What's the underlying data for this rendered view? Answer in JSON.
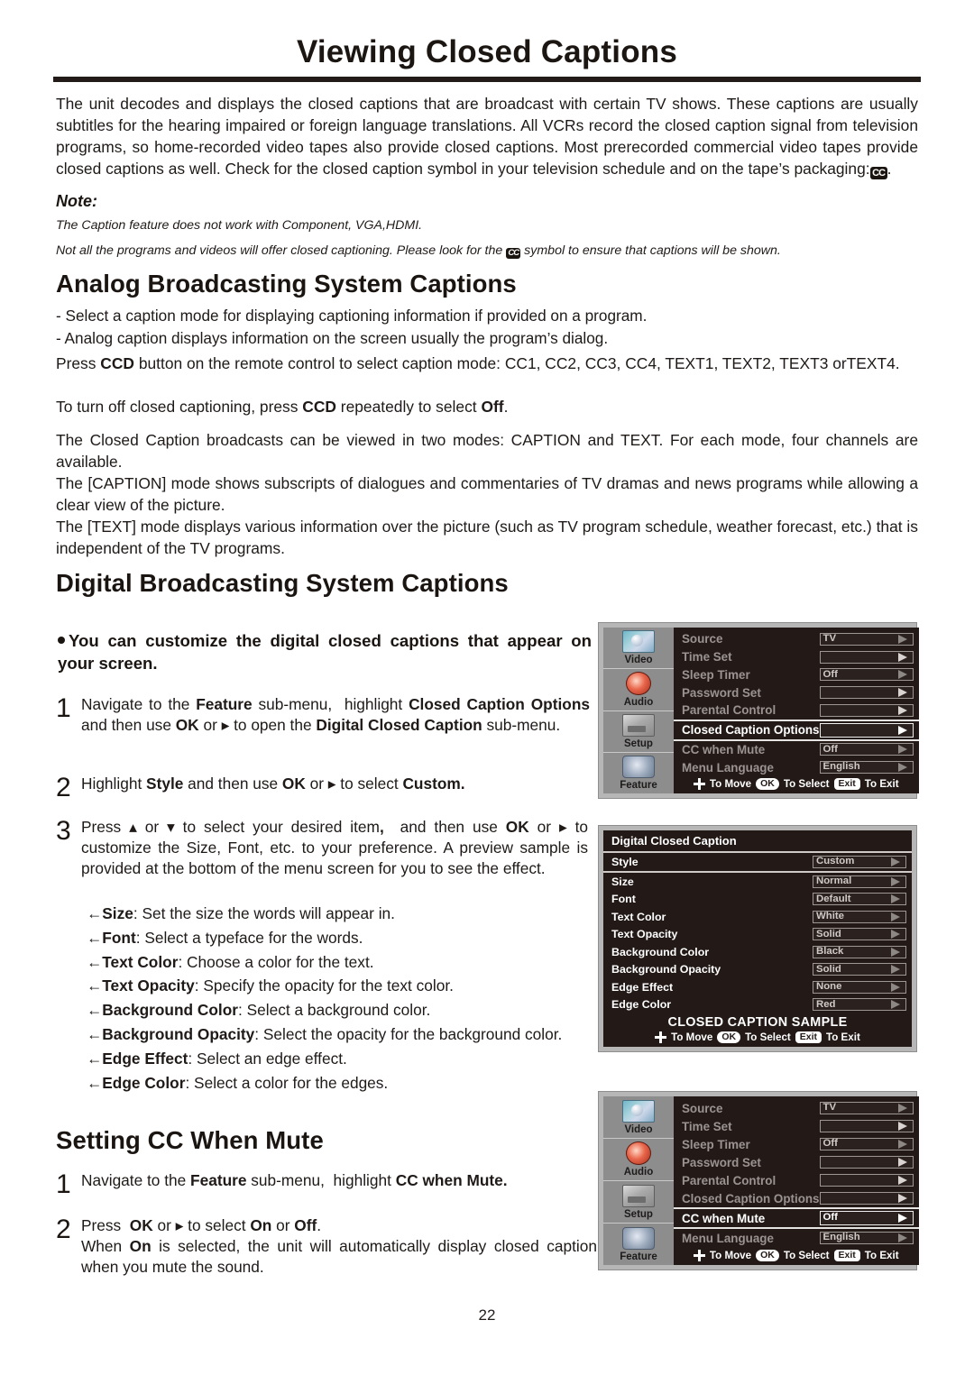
{
  "page": {
    "title": "Viewing Closed Captions",
    "number": "22"
  },
  "intro": {
    "paragraph_html": "The unit decodes and displays the closed captions that are broadcast with certain TV shows. These captions are usually subtitles for the hearing impaired or foreign language translations. All VCRs record the closed caption signal from television programs, so home-recorded video tapes also provide closed captions. Most prerecorded commercial video tapes provide closed captions as well. Check for the closed caption symbol in your television schedule and on the tape’s packaging:",
    "cc_symbol": "CC",
    "trailing": "."
  },
  "note": {
    "label": "Note:",
    "lines_1": "The Caption feature does not work with Component, VGA,HDMI.",
    "lines_2a": "Not all the programs and videos will offer closed captioning. Please look for the",
    "lines_2b": "symbol to ensure that captions will be shown.",
    "cc_symbol": "CC"
  },
  "analog": {
    "heading": "Analog Broadcasting System Captions",
    "dash1": "- Select a caption mode for displaying captioning information if provided on a program.",
    "dash2": "- Analog caption displays information on the screen usually the program’s dialog.",
    "p1_a": "Press ",
    "p1_b": "CCD",
    "p1_c": " button on the remote control to select caption mode: CC1, CC2, CC3, CC4, TEXT1, TEXT2, TEXT3 orTEXT4.",
    "p2_a": "To turn off closed captioning, press ",
    "p2_b": "CCD",
    "p2_c": " repeatedly to select ",
    "p2_d": "Off",
    "p2_e": ".",
    "p3": "The Closed Caption broadcasts can be viewed in two modes: CAPTION and TEXT. For each mode, four channels are available.",
    "p4": "The [CAPTION] mode shows subscripts of dialogues and commentaries of TV dramas and news programs while allowing a clear view of the picture.",
    "p5": "The [TEXT] mode displays various information over the picture (such as TV program schedule, weather forecast, etc.) that is independent of the TV programs."
  },
  "digital": {
    "heading": "Digital Broadcasting System Captions",
    "bullet": "You can customize the digital closed captions that appear on your screen.",
    "steps": [
      {
        "num": "1",
        "text_html": "Navigate to the <b>Feature</b> sub-menu,&nbsp; highlight <b>Closed Caption Options</b> and then use <b>OK</b> or &#9656; to open the <b>Digital Closed Caption</b> sub-menu."
      },
      {
        "num": "2",
        "text_html": "Highlight <b>Style</b> and then use <b>OK</b> or &#9656; to select <b>Custom.</b>"
      },
      {
        "num": "3",
        "text_html": "Press &#9652; or &#9662; to select your desired item<b>,</b>&nbsp; and then use <b>OK</b> or &#9656; to customize the Size, Font, etc. to your preference. A preview sample is provided at the bottom of the menu screen for you to see the effect."
      }
    ],
    "arrow_items": [
      {
        "term": "Size",
        "desc": ": Set the size the words will appear in."
      },
      {
        "term": "Font",
        "desc": ": Select a typeface for the words."
      },
      {
        "term": "Text Color",
        "desc": ": Choose a color for the text."
      },
      {
        "term": "Text Opacity",
        "desc": ": Specify the opacity for the text color."
      },
      {
        "term": "Background Color",
        "desc": ": Select a background color."
      },
      {
        "term": "Background Opacity",
        "desc": ": Select the opacity for the background color."
      },
      {
        "term": "Edge Effect",
        "desc": ": Select an edge effect."
      },
      {
        "term": "Edge Color",
        "desc": ": Select a color for the edges."
      }
    ]
  },
  "cc_mute": {
    "heading": "Setting CC When Mute",
    "steps": [
      {
        "num": "1",
        "text_html": "Navigate to the <b>Feature</b> sub-menu,&nbsp; highlight <b>CC when Mute.</b>"
      },
      {
        "num": "2",
        "text_html": "Press&nbsp; <b>OK</b> or &#9656; to select <b>On</b> or <b>Off</b>.<br>When <b>On</b> is selected, the unit will automatically display closed caption when you mute the sound."
      }
    ]
  },
  "osd_common": {
    "sidebar": [
      {
        "label": "Video",
        "icon": "video-thumbnail-icon"
      },
      {
        "label": "Audio",
        "icon": "audio-speaker-icon"
      },
      {
        "label": "Setup",
        "icon": "setup-tools-icon"
      },
      {
        "label": "Feature",
        "icon": "feature-gear-icon"
      }
    ],
    "footer": {
      "move": "To Move",
      "ok": "OK",
      "select": "To Select",
      "exit_key": "Exit",
      "exit": "To Exit"
    }
  },
  "osd_feature_menu_1": {
    "rows": [
      {
        "label": "Source",
        "value": "TV",
        "highlighted": false
      },
      {
        "label": "Time Set",
        "value": "",
        "highlighted": false
      },
      {
        "label": "Sleep Timer",
        "value": "Off",
        "highlighted": false
      },
      {
        "label": "Password Set",
        "value": "",
        "highlighted": false
      },
      {
        "label": "Parental Control",
        "value": "",
        "highlighted": false
      },
      {
        "label": "Closed Caption Options",
        "value": "",
        "highlighted": true
      },
      {
        "label": "CC when Mute",
        "value": "Off",
        "highlighted": false
      },
      {
        "label": "Menu Language",
        "value": "English",
        "highlighted": false
      }
    ]
  },
  "osd_digital_caption_menu": {
    "title": "Digital Closed Caption",
    "rows": [
      {
        "label": "Style",
        "value": "Custom",
        "highlighted": true
      },
      {
        "label": "Size",
        "value": "Normal",
        "highlighted": false
      },
      {
        "label": "Font",
        "value": "Default",
        "highlighted": false
      },
      {
        "label": "Text Color",
        "value": "White",
        "highlighted": false
      },
      {
        "label": "Text Opacity",
        "value": "Solid",
        "highlighted": false
      },
      {
        "label": "Background Color",
        "value": "Black",
        "highlighted": false
      },
      {
        "label": "Background Opacity",
        "value": "Solid",
        "highlighted": false
      },
      {
        "label": "Edge Effect",
        "value": "None",
        "highlighted": false
      },
      {
        "label": "Edge Color",
        "value": "Red",
        "highlighted": false
      }
    ],
    "sample_text": "CLOSED CAPTION SAMPLE"
  },
  "osd_feature_menu_2": {
    "rows": [
      {
        "label": "Source",
        "value": "TV",
        "highlighted": false
      },
      {
        "label": "Time Set",
        "value": "",
        "highlighted": false
      },
      {
        "label": "Sleep Timer",
        "value": "Off",
        "highlighted": false
      },
      {
        "label": "Password Set",
        "value": "",
        "highlighted": false
      },
      {
        "label": "Parental Control",
        "value": "",
        "highlighted": false
      },
      {
        "label": "Closed Caption Options",
        "value": "",
        "highlighted": false
      },
      {
        "label": "CC when Mute",
        "value": "Off",
        "highlighted": true
      },
      {
        "label": "Menu Language",
        "value": "English",
        "highlighted": false
      }
    ]
  }
}
